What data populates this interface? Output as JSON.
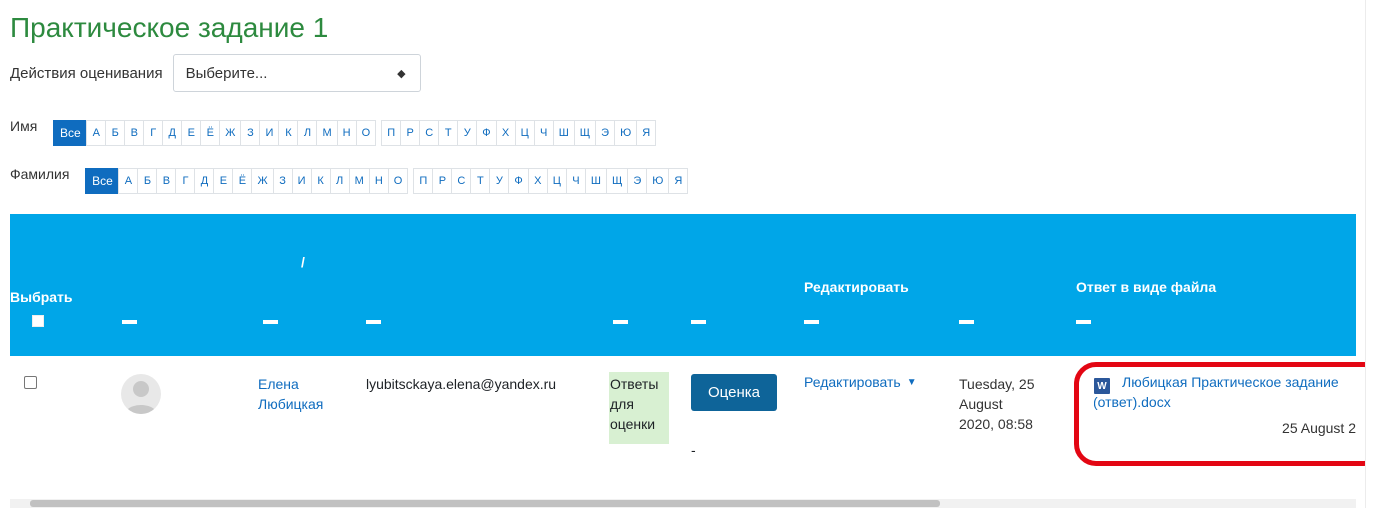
{
  "page": {
    "title": "Практическое задание 1"
  },
  "grading_actions": {
    "label": "Действия оценивания",
    "select_value": "Выберите..."
  },
  "initials": {
    "first_name_label": "Имя",
    "last_name_label": "Фамилия",
    "all_label": "Все",
    "groups": [
      [
        "А",
        "Б",
        "В",
        "Г",
        "Д",
        "Е",
        "Ё",
        "Ж",
        "З",
        "И",
        "К",
        "Л",
        "М",
        "Н",
        "О"
      ],
      [
        "П",
        "Р",
        "С",
        "Т",
        "У",
        "Ф",
        "Х",
        "Ц",
        "Ч",
        "Ш",
        "Щ",
        "Э",
        "Ю",
        "Я"
      ]
    ]
  },
  "table": {
    "headers": {
      "select": "Выбрать",
      "slash": "/",
      "edit": "Редактировать",
      "file_submission": "Ответ в виде файла"
    },
    "row": {
      "first_name": "Елена",
      "last_name": "Любицкая",
      "email": "lyubitsckaya.elena@yandex.ru",
      "status_lines": [
        "Ответы",
        "для",
        "оценки"
      ],
      "grade_button": "Оценка",
      "grade_value": "-",
      "edit_label": "Редактировать",
      "modified_lines": [
        "Tuesday, 25",
        "August",
        "2020, 08:58"
      ],
      "file_name_line1": "Любицкая Практическое задание",
      "file_name_line2": "(ответ).docx",
      "file_date": "25 August 2",
      "doc_icon_letter": "W"
    }
  },
  "colors": {
    "title": "#2d8a3f",
    "header_bg": "#00a6e8",
    "link": "#0f6cbf",
    "status_bg": "#d8f0d2",
    "grade_button": "#0e6499",
    "highlight": "#e30613"
  }
}
